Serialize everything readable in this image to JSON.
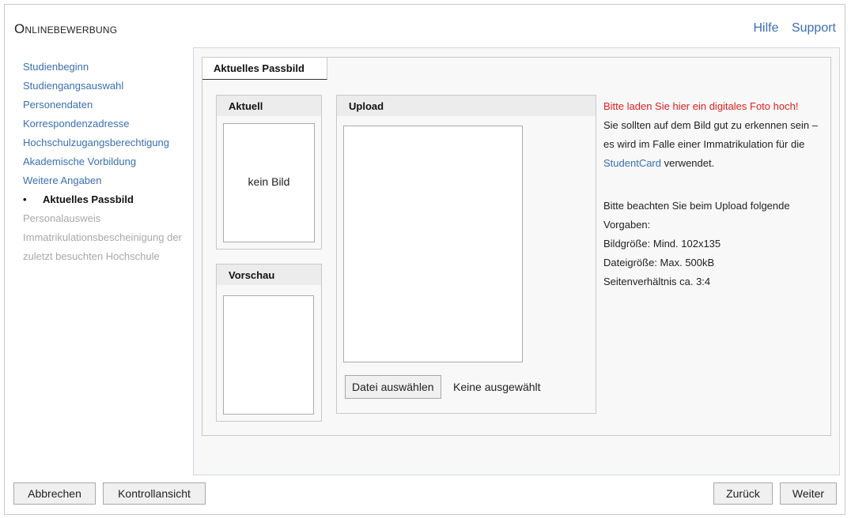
{
  "header": {
    "title": "Onlinebewerbung",
    "links": {
      "help": "Hilfe",
      "support": "Support"
    }
  },
  "nav": {
    "items": [
      {
        "label": "Studienbeginn"
      },
      {
        "label": "Studiengangsauswahl"
      },
      {
        "label": "Personendaten"
      },
      {
        "label": "Korrespondenzadresse"
      },
      {
        "label": "Hochschulzugangsberechtigung"
      },
      {
        "label": "Akademische Vorbildung"
      },
      {
        "label": "Weitere Angaben"
      },
      {
        "label": "Aktuelles Passbild"
      },
      {
        "label": "Personalausweis"
      },
      {
        "label": "Immatrikulationsbescheinigung der"
      },
      {
        "label": "zuletzt besuchten Hochschule"
      }
    ]
  },
  "tab": {
    "label": "Aktuelles Passbild"
  },
  "current": {
    "heading": "Aktuell",
    "no_image": "kein Bild"
  },
  "preview": {
    "heading": "Vorschau"
  },
  "upload": {
    "heading": "Upload",
    "button": "Datei auswählen",
    "status": "Keine ausgewählt"
  },
  "info": {
    "highlight": "Bitte laden Sie hier ein digitales Foto hoch!",
    "text1": "Sie sollten auf dem Bild gut zu erkennen sein – es wird im Falle einer Immatrikulation für die",
    "link": "StudentCard",
    "text2": "verwendet.",
    "rules_intro": "Bitte beachten Sie beim Upload folgende Vorgaben:",
    "rules": [
      "Bildgröße: Mind. 102x135",
      "Dateigröße: Max. 500kB",
      "Seitenverhältnis ca. 3:4"
    ]
  },
  "footer": {
    "cancel": "Abbrechen",
    "review": "Kontrollansicht",
    "back": "Zurück",
    "next": "Weiter"
  },
  "colors": {
    "link": "#3a6fb0",
    "highlight": "#e02020",
    "disabled": "#a8a8a8"
  }
}
